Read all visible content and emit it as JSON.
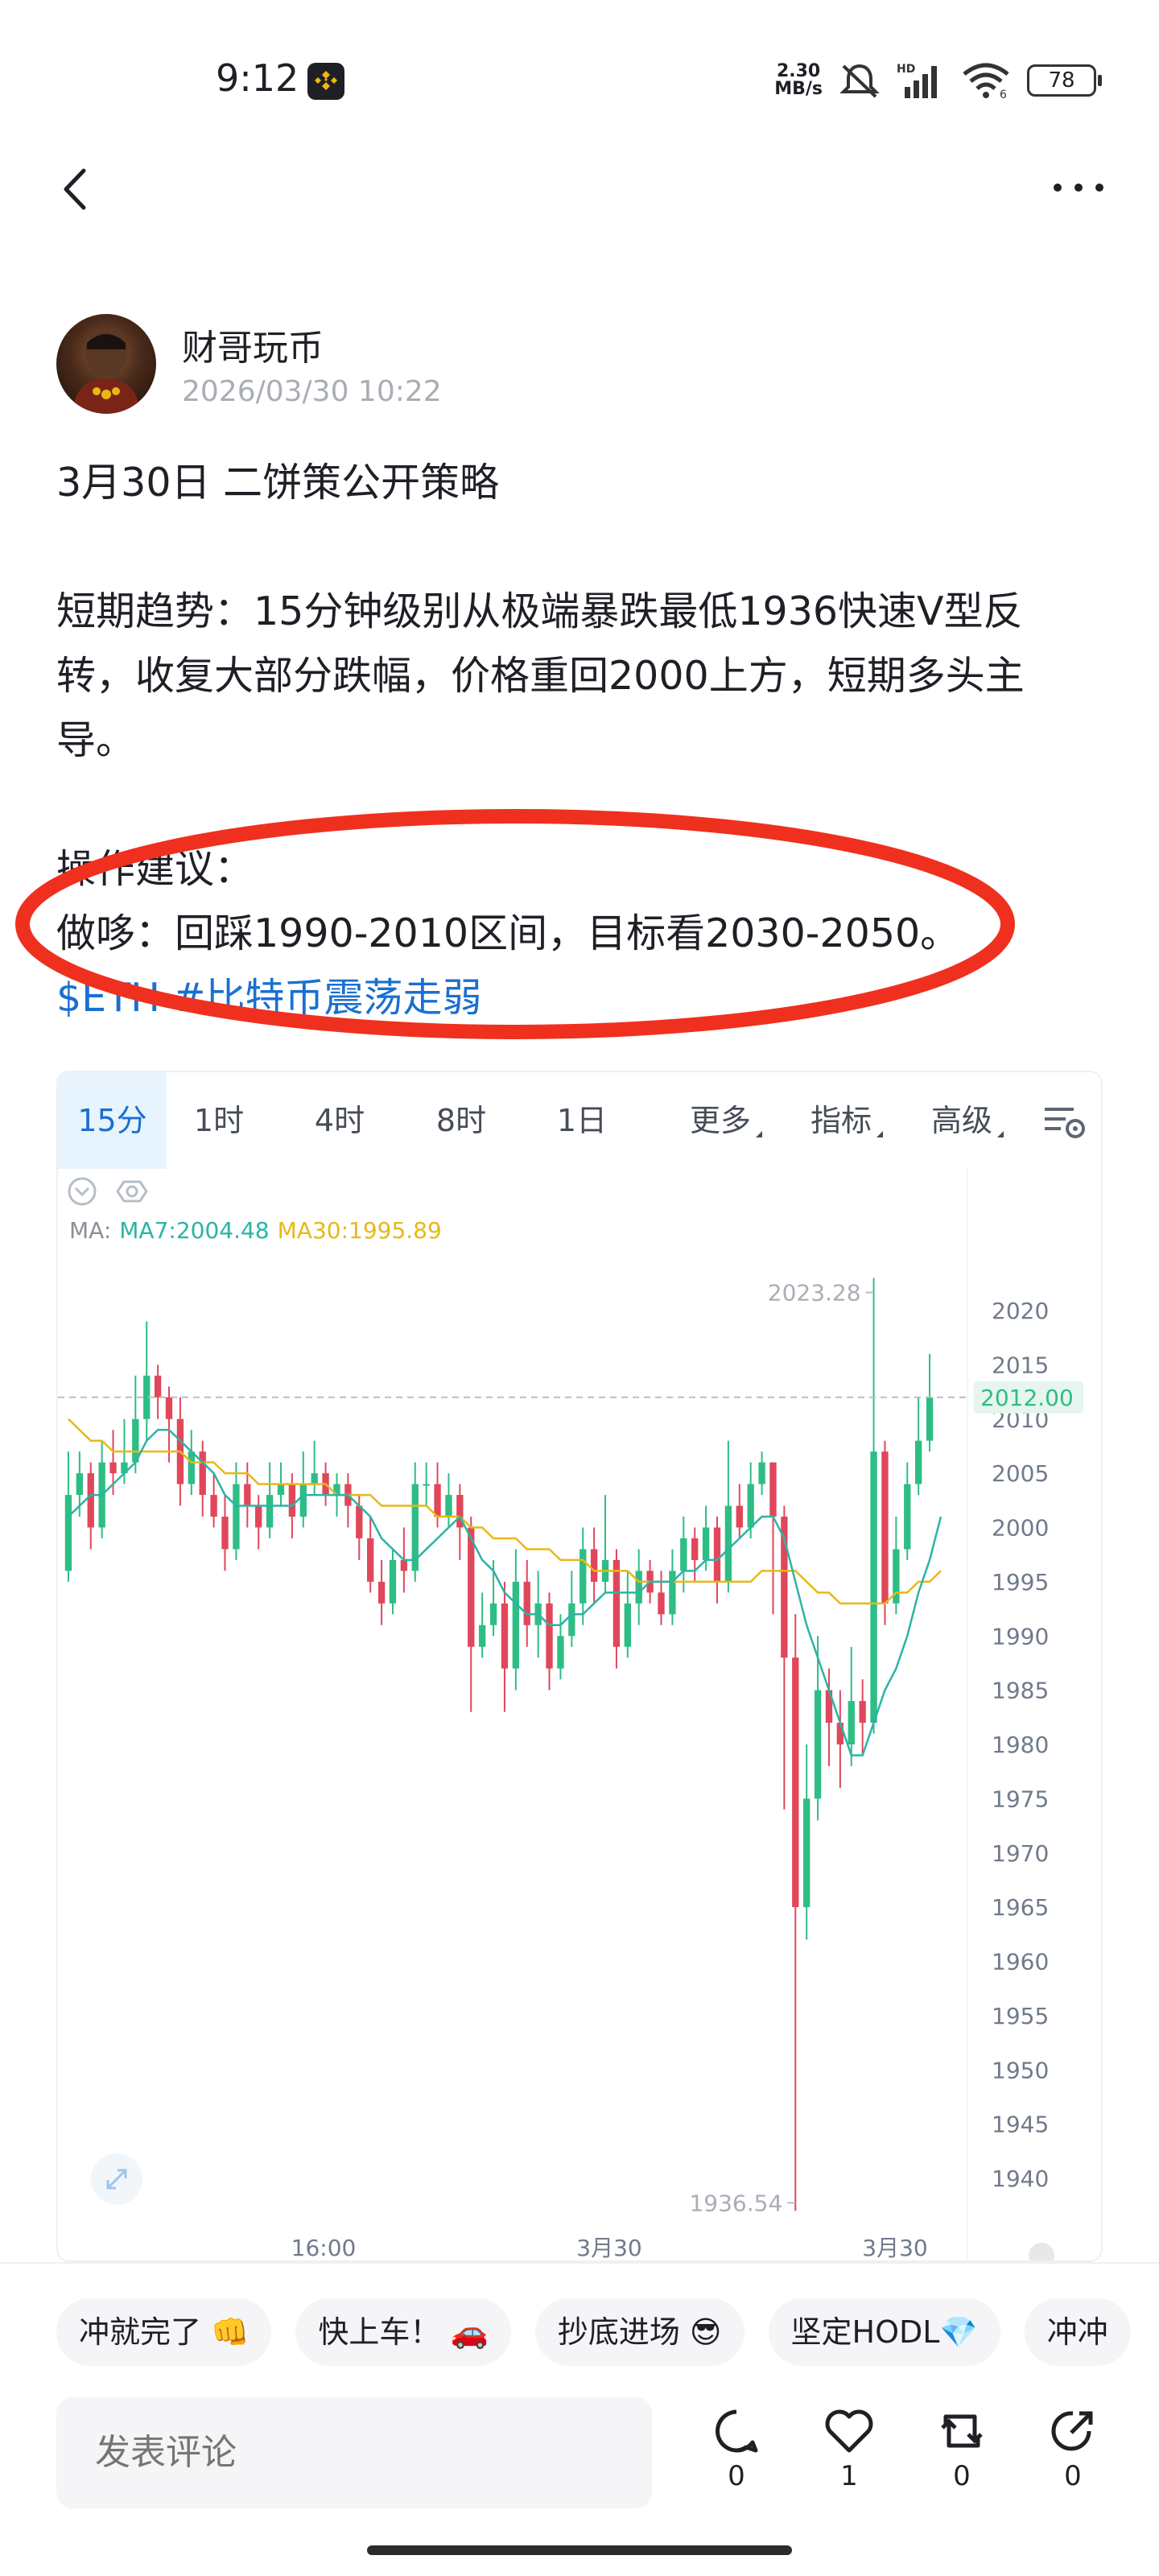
{
  "status_bar": {
    "time": "9:12",
    "net_speed_value": "2.30",
    "net_speed_unit": "MB/s",
    "battery": "78"
  },
  "post": {
    "author": "财哥玩币",
    "timestamp": "2026/03/30 10:22",
    "title": "3月30日 二饼策公开策略",
    "trend_line1": "短期趋势：15分钟级别从极端暴跌最低1936快速V型反",
    "trend_line2": "转，收复大部分跌幅，价格重回2000上方，短期多头主",
    "trend_line3": "导。",
    "advice_heading": "操作建议：",
    "advice": "做哆：回踩1990-2010区间，目标看2030-2050。",
    "hashtags": "$ETH #比特币震荡走弱"
  },
  "chart_tabs": [
    {
      "label": "15分",
      "active": true
    },
    {
      "label": "1时",
      "active": false
    },
    {
      "label": "4时",
      "active": false
    },
    {
      "label": "8时",
      "active": false
    },
    {
      "label": "1日",
      "active": false
    },
    {
      "label": "更多",
      "active": false
    },
    {
      "label": "指标",
      "active": false
    },
    {
      "label": "高级",
      "active": false
    }
  ],
  "chart_indicators": {
    "ma_label": "MA:",
    "ma7": "MA7:2004.48",
    "ma30": "MA30:1995.89"
  },
  "chart_data": {
    "type": "candlestick",
    "interval": "15分",
    "y_ticks": [
      2020,
      2015,
      2010,
      2005,
      2000,
      1995,
      1990,
      1985,
      1980,
      1975,
      1970,
      1965,
      1960,
      1955,
      1950,
      1945,
      1940
    ],
    "x_ticks": [
      "16:00",
      "3月30",
      "3月30"
    ],
    "ylim": [
      1936,
      2024
    ],
    "current_price": "2012.00",
    "high_label": "2023.28",
    "low_label": "1936.54",
    "colors": {
      "up": "#2ebd85",
      "down": "#e0475b",
      "ma7": "#2ab4a6",
      "ma30": "#e8b818",
      "price_tag_bg": "#e6f6ef"
    },
    "candles": [
      [
        1996,
        2003,
        2007,
        1995
      ],
      [
        2003,
        2005,
        2007,
        2001
      ],
      [
        2005,
        2000,
        2006,
        1998
      ],
      [
        2000,
        2006,
        2008,
        1999
      ],
      [
        2006,
        2005,
        2009,
        2003
      ],
      [
        2005,
        2006,
        2010,
        2004
      ],
      [
        2006,
        2010,
        2014,
        2005
      ],
      [
        2010,
        2014,
        2019,
        2008
      ],
      [
        2014,
        2012,
        2015,
        2010
      ],
      [
        2012,
        2010,
        2013,
        2006
      ],
      [
        2010,
        2004,
        2012,
        2002
      ],
      [
        2004,
        2007,
        2009,
        2003
      ],
      [
        2007,
        2003,
        2008,
        2001
      ],
      [
        2003,
        2001,
        2005,
        2000
      ],
      [
        2001,
        1998,
        2003,
        1996
      ],
      [
        1998,
        2004,
        2006,
        1997
      ],
      [
        2004,
        2002,
        2006,
        2000
      ],
      [
        2002,
        2000,
        2003,
        1998
      ],
      [
        2000,
        2003,
        2006,
        1999
      ],
      [
        2003,
        2004,
        2006,
        2002
      ],
      [
        2004,
        2001,
        2005,
        1999
      ],
      [
        2001,
        2004,
        2007,
        2000
      ],
      [
        2004,
        2005,
        2008,
        2003
      ],
      [
        2005,
        2003,
        2006,
        2002
      ],
      [
        2003,
        2004,
        2005,
        2001
      ],
      [
        2004,
        2002,
        2005,
        2000
      ],
      [
        2002,
        1999,
        2003,
        1997
      ],
      [
        1999,
        1995,
        2001,
        1994
      ],
      [
        1995,
        1993,
        1997,
        1991
      ],
      [
        1993,
        1997,
        1998,
        1992
      ],
      [
        1997,
        1996,
        2000,
        1994
      ],
      [
        1996,
        2004,
        2006,
        1995
      ],
      [
        2004,
        2004,
        2006,
        2002
      ],
      [
        2004,
        2001,
        2006,
        2000
      ],
      [
        2001,
        2003,
        2005,
        2000
      ],
      [
        2003,
        2000,
        2004,
        1997
      ],
      [
        2000,
        1989,
        2001,
        1983
      ],
      [
        1989,
        1991,
        1994,
        1988
      ],
      [
        1991,
        1993,
        1997,
        1990
      ],
      [
        1993,
        1987,
        1995,
        1983
      ],
      [
        1987,
        1995,
        1998,
        1985
      ],
      [
        1995,
        1991,
        1997,
        1989
      ],
      [
        1991,
        1993,
        1996,
        1988
      ],
      [
        1993,
        1987,
        1994,
        1985
      ],
      [
        1987,
        1990,
        1992,
        1986
      ],
      [
        1990,
        1993,
        1996,
        1989
      ],
      [
        1993,
        1998,
        2000,
        1991
      ],
      [
        1998,
        1995,
        2000,
        1993
      ],
      [
        1995,
        1997,
        2003,
        1994
      ],
      [
        1997,
        1989,
        1998,
        1987
      ],
      [
        1989,
        1993,
        1996,
        1988
      ],
      [
        1993,
        1996,
        1998,
        1991
      ],
      [
        1996,
        1994,
        1997,
        1993
      ],
      [
        1994,
        1992,
        1996,
        1991
      ],
      [
        1992,
        1996,
        1998,
        1991
      ],
      [
        1996,
        1999,
        2001,
        1994
      ],
      [
        1999,
        1997,
        2000,
        1995
      ],
      [
        1997,
        2000,
        2002,
        1996
      ],
      [
        2000,
        1995,
        2001,
        1993
      ],
      [
        1995,
        2002,
        2008,
        1994
      ],
      [
        2002,
        2000,
        2004,
        1999
      ],
      [
        2000,
        2004,
        2006,
        1999
      ],
      [
        2004,
        2006,
        2007,
        2003
      ],
      [
        2006,
        2001,
        2006,
        1992
      ],
      [
        2001,
        1988,
        2002,
        1974
      ],
      [
        1988,
        1965,
        1992,
        1937
      ],
      [
        1965,
        1975,
        1980,
        1962
      ],
      [
        1975,
        1985,
        1990,
        1973
      ],
      [
        1985,
        1982,
        1987,
        1978
      ],
      [
        1982,
        1980,
        1985,
        1976
      ],
      [
        1980,
        1984,
        1989,
        1978
      ],
      [
        1984,
        1982,
        1986,
        1979
      ],
      [
        1982,
        2007,
        2023,
        1981
      ],
      [
        2007,
        1993,
        2008,
        1991
      ],
      [
        1993,
        1998,
        2001,
        1992
      ],
      [
        1998,
        2004,
        2006,
        1997
      ],
      [
        2004,
        2008,
        2012,
        2003
      ],
      [
        2008,
        2012,
        2016,
        2007
      ]
    ],
    "ma7": [
      2001,
      2002,
      2003,
      2003,
      2004,
      2005,
      2006,
      2008,
      2009,
      2009,
      2008,
      2007,
      2006,
      2005,
      2003,
      2002,
      2002,
      2002,
      2002,
      2002,
      2002,
      2003,
      2003,
      2003,
      2003,
      2003,
      2002,
      2001,
      1999,
      1998,
      1997,
      1997,
      1998,
      1999,
      2000,
      2001,
      1999,
      1997,
      1996,
      1994,
      1993,
      1992,
      1992,
      1991,
      1991,
      1992,
      1992,
      1993,
      1994,
      1994,
      1994,
      1994,
      1995,
      1995,
      1995,
      1996,
      1996,
      1997,
      1997,
      1998,
      1999,
      2000,
      2001,
      2001,
      1999,
      1995,
      1991,
      1988,
      1985,
      1982,
      1979,
      1979,
      1982,
      1985,
      1987,
      1990,
      1994,
      1997,
      2001
    ],
    "ma30": [
      2010,
      2009,
      2008,
      2008,
      2007,
      2007,
      2007,
      2007,
      2007,
      2007,
      2007,
      2006,
      2006,
      2006,
      2005,
      2005,
      2005,
      2004,
      2004,
      2004,
      2004,
      2004,
      2004,
      2004,
      2003,
      2003,
      2003,
      2003,
      2002,
      2002,
      2002,
      2002,
      2002,
      2001,
      2001,
      2001,
      2000,
      2000,
      1999,
      1999,
      1999,
      1998,
      1998,
      1998,
      1997,
      1997,
      1997,
      1996,
      1996,
      1996,
      1996,
      1995,
      1995,
      1995,
      1995,
      1995,
      1995,
      1995,
      1995,
      1995,
      1995,
      1995,
      1996,
      1996,
      1996,
      1996,
      1995,
      1994,
      1994,
      1993,
      1993,
      1993,
      1993,
      1993,
      1994,
      1994,
      1995,
      1995,
      1996
    ]
  },
  "reactions": [
    "冲就完了 👊",
    "快上车！ 🚗",
    "抄底进场 😎",
    "坚定HODL💎",
    "冲冲"
  ],
  "comment": {
    "placeholder": "发表评论"
  },
  "actions": {
    "comments": "0",
    "likes": "1",
    "reposts": "0",
    "shares": "0"
  }
}
